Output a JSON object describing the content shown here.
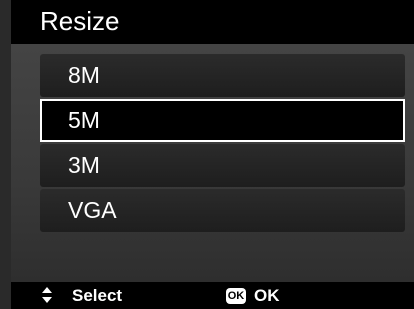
{
  "header": {
    "title": "Resize"
  },
  "menu": {
    "options": [
      {
        "label": "8M",
        "selected": false
      },
      {
        "label": "5M",
        "selected": true
      },
      {
        "label": "3M",
        "selected": false
      },
      {
        "label": "VGA",
        "selected": false
      }
    ]
  },
  "footer": {
    "select_icon": "up-down-arrows-icon",
    "select_label": "Select",
    "ok_badge": "OK",
    "ok_label": "OK"
  }
}
